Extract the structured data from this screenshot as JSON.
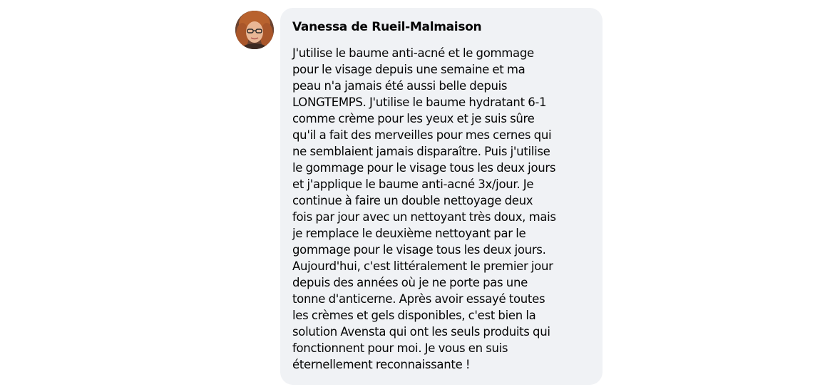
{
  "comment": {
    "avatar_icon": "user-avatar-photo",
    "author": "Vanessa de Rueil-Malmaison",
    "text_lines": [
      "J'utilise le baume anti-acné et le gommage",
      "pour le visage depuis une semaine et ma",
      "peau n'a jamais été aussi belle depuis",
      "LONGTEMPS. J'utilise le baume hydratant 6-1",
      "comme crème pour les yeux et je suis sûre",
      "qu'il a fait des merveilles pour mes cernes qui",
      "ne semblaient jamais disparaître. Puis j'utilise",
      "le gommage pour le visage tous les deux jours",
      "et j'applique le baume anti-acné 3x/jour. Je",
      "continue à faire un double nettoyage deux",
      "fois par jour avec un nettoyant très doux, mais",
      "je remplace le deuxième nettoyant par le",
      "gommage pour le visage tous les deux jours.",
      "Aujourd'hui, c'est littéralement le premier jour",
      "depuis des années où je ne porte pas une",
      "tonne d'anticerne. Après avoir essayé toutes",
      "les crèmes et gels disponibles, c'est bien la",
      "solution Avensta qui ont les seuls produits qui",
      "fonctionnent pour moi. Je vous en suis",
      "éternellement reconnaissante !"
    ]
  },
  "colors": {
    "bubble_background": "#f0f2f5",
    "text": "#050505",
    "page_background": "#ffffff"
  }
}
